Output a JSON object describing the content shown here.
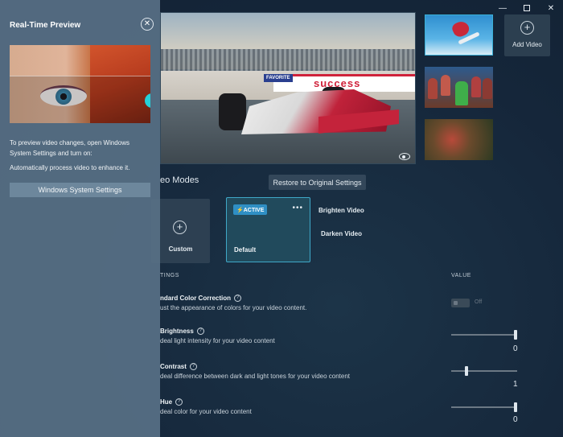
{
  "window": {
    "minimize": "—",
    "close": "✕"
  },
  "thumbnails": {
    "add_label": "Add Video",
    "add_symbol": "+"
  },
  "video_modes": {
    "title": "eo Modes",
    "restore_label": "Restore to Original Settings",
    "custom_label": "Custom",
    "add_symbol": "+",
    "active_badge": "⚡ACTIVE",
    "more_symbol": "•••",
    "default_label": "Default",
    "brighten_label": "Brighten Video",
    "darken_label": "Darken Video"
  },
  "settings": {
    "header_left": "TINGS",
    "header_right": "VALUE",
    "help_symbol": "?",
    "items": [
      {
        "title": "ndard Color Correction",
        "desc": "ust the appearance of colors for your video content.",
        "toggle_label": "Off",
        "toggle_on": false
      },
      {
        "title": "Brightness",
        "desc": "deal light intensity for your video content",
        "value": "0",
        "level": 1.0
      },
      {
        "title": "Contrast",
        "desc": "deal difference between dark and light tones for your video content",
        "value": "1",
        "level": 0.22
      },
      {
        "title": "Hue",
        "desc": "deal color for your video content",
        "value": "0",
        "level": 1.0
      }
    ]
  },
  "preview_panel": {
    "title": "Real-Time Preview",
    "close_symbol": "✕",
    "instructions": "To preview video changes, open Windows System Settings and turn on:",
    "setting_name": "Automatically process video to enhance it.",
    "button_label": "Windows System Settings"
  },
  "main_video": {
    "banner_text": "success",
    "sponsor_text": "FAVORITE"
  }
}
